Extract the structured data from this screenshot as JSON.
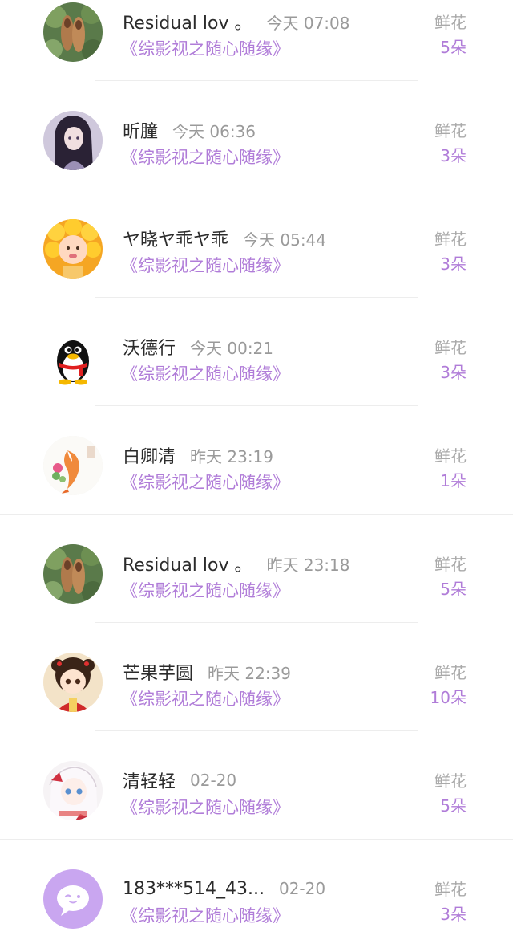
{
  "records": [
    {
      "name": "Residual lov 。",
      "time": "今天 07:08",
      "book": "《综影视之随心随缘》",
      "gift_label": "鲜花",
      "gift_count": "5朵",
      "avatar_icon": "couple-shoes-avatar-icon"
    },
    {
      "name": "昕朣",
      "time": "今天 06:36",
      "book": "《综影视之随心随缘》",
      "gift_label": "鲜花",
      "gift_count": "3朵",
      "avatar_icon": "anime-girl-avatar-icon"
    },
    {
      "name": "ヤ晓ヤ乖ヤ乖",
      "time": "今天 05:44",
      "book": "《综影视之随心随缘》",
      "gift_label": "鲜花",
      "gift_count": "3朵",
      "avatar_icon": "baby-flower-avatar-icon"
    },
    {
      "name": "沃德行",
      "time": "今天 00:21",
      "book": "《综影视之随心随缘》",
      "gift_label": "鲜花",
      "gift_count": "3朵",
      "avatar_icon": "penguin-avatar-icon"
    },
    {
      "name": "白卿清",
      "time": "昨天 23:19",
      "book": "《综影视之随心随缘》",
      "gift_label": "鲜花",
      "gift_count": "1朵",
      "avatar_icon": "koi-fish-avatar-icon"
    },
    {
      "name": "Residual lov 。",
      "time": "昨天 23:18",
      "book": "《综影视之随心随缘》",
      "gift_label": "鲜花",
      "gift_count": "5朵",
      "avatar_icon": "couple-shoes-avatar-icon"
    },
    {
      "name": "芒果芋圆",
      "time": "昨天 22:39",
      "book": "《综影视之随心随缘》",
      "gift_label": "鲜花",
      "gift_count": "10朵",
      "avatar_icon": "chibi-girl-avatar-icon"
    },
    {
      "name": "清轻轻",
      "time": "02-20",
      "book": "《综影视之随心随缘》",
      "gift_label": "鲜花",
      "gift_count": "5朵",
      "avatar_icon": "anime-white-hair-avatar-icon"
    },
    {
      "name": "183***514_43...",
      "time": "02-20",
      "book": "《综影视之随心随缘》",
      "gift_label": "鲜花",
      "gift_count": "3朵",
      "avatar_icon": "default-chat-avatar-icon"
    }
  ],
  "colors": {
    "accent_purple": "#b07cd8",
    "name_text": "#2b2b2b",
    "muted_text": "#9a9a9a"
  }
}
